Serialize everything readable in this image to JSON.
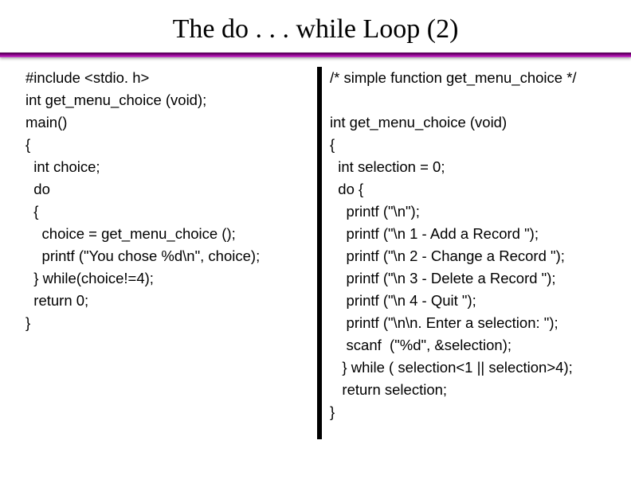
{
  "title": "The do . . . while Loop (2)",
  "left_code": [
    "#include <stdio. h>",
    "int get_menu_choice (void);",
    "main()",
    "{",
    "  int choice;",
    "  do",
    "  {",
    "    choice = get_menu_choice ();",
    "    printf (\"You chose %d\\n\", choice);",
    "  } while(choice!=4);",
    "  return 0;",
    "}"
  ],
  "right_code": [
    "/* simple function get_menu_choice */",
    "",
    "int get_menu_choice (void)",
    "{",
    "  int selection = 0;",
    "  do {",
    "    printf (\"\\n\");",
    "    printf (\"\\n 1 - Add a Record \");",
    "    printf (\"\\n 2 - Change a Record \");",
    "    printf (\"\\n 3 - Delete a Record \");",
    "    printf (\"\\n 4 - Quit \");",
    "    printf (\"\\n\\n. Enter a selection: \");",
    "    scanf  (\"%d\", &selection);",
    "   } while ( selection<1 || selection>4);",
    "   return selection;",
    "}"
  ]
}
